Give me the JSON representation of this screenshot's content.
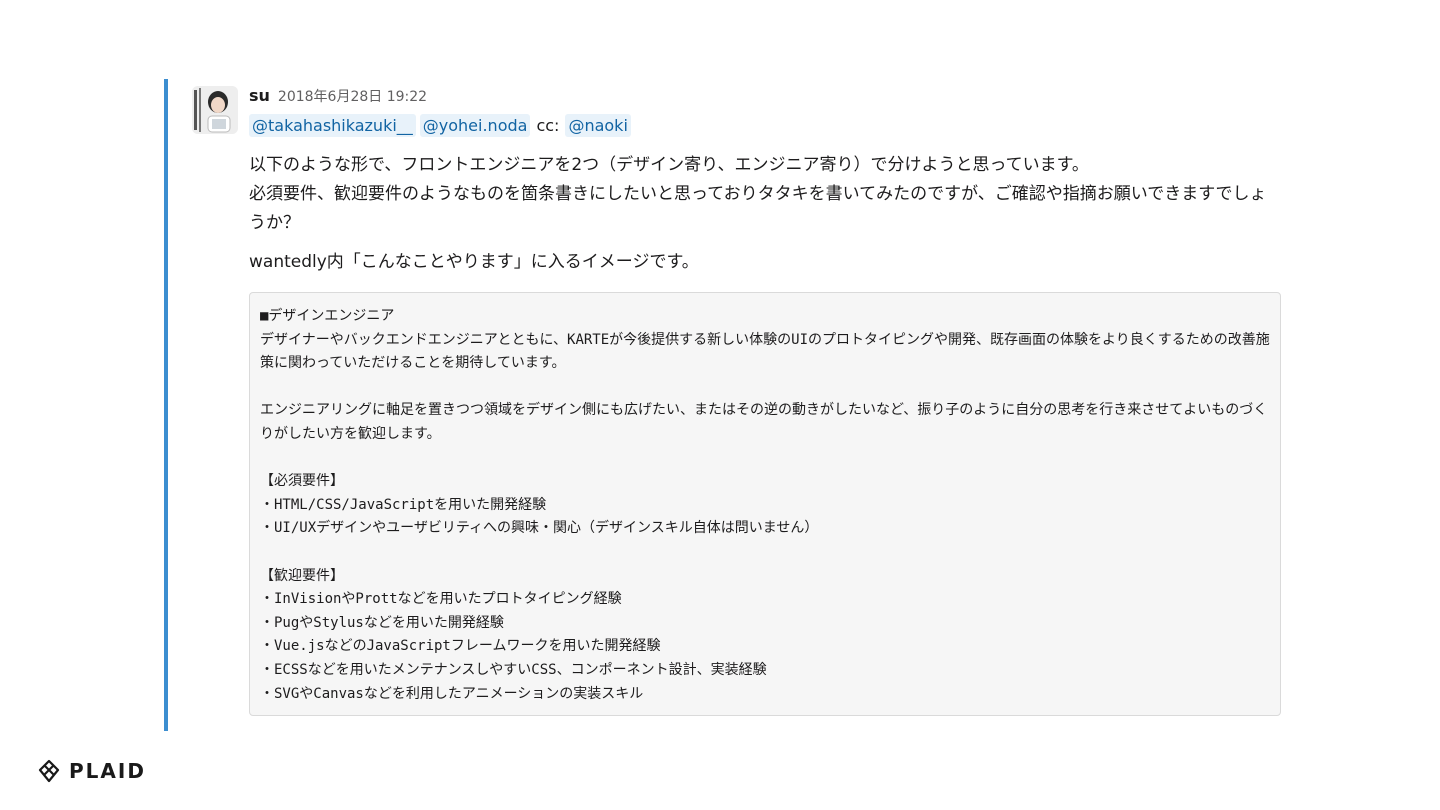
{
  "message": {
    "author": "su",
    "timestamp": "2018年6月28日 19:22",
    "mentions": [
      "@takahashikazuki__",
      "@yohei.noda"
    ],
    "cc_label": "cc:",
    "cc_mention": "@naoki",
    "paragraphs": [
      "以下のような形で、フロントエンジニアを2つ（デザイン寄り、エンジニア寄り）で分けようと思っています。",
      "必須要件、歓迎要件のようなものを箇条書きにしたいと思っておりタタキを書いてみたのですが、ご確認や指摘お願いできますでしょうか？",
      "wantedly内「こんなことやります」に入るイメージです。"
    ],
    "code_lines": [
      "■デザインエンジニア",
      "デザイナーやバックエンドエンジニアとともに、KARTEが今後提供する新しい体験のUIのプロトタイピングや開発、既存画面の体験をより良くするための改善施策に関わっていただけることを期待しています。",
      "",
      "エンジニアリングに軸足を置きつつ領域をデザイン側にも広げたい、またはその逆の動きがしたいなど、振り子のように自分の思考を行き来させてよいものづくりがしたい方を歓迎します。",
      "",
      "【必須要件】",
      "・HTML/CSS/JavaScriptを用いた開発経験",
      "・UI/UXデザインやユーザビリティへの興味・関心（デザインスキル自体は問いません）",
      "",
      "【歓迎要件】",
      "・InVisionやProttなどを用いたプロトタイピング経験",
      "・PugやStylusなどを用いた開発経験",
      "・Vue.jsなどのJavaScriptフレームワークを用いた開発経験",
      "・ECSSなどを用いたメンテナンスしやすいCSS、コンポーネント設計、実装経験",
      "・SVGやCanvasなどを利用したアニメーションの実装スキル"
    ]
  },
  "logo": {
    "text": "PLAID",
    "icon": "plaid-logo-icon"
  },
  "colors": {
    "quote_bar": "#3c8ed0",
    "mention_text": "#1264a3",
    "mention_bg": "#e8f2fa",
    "code_bg": "#f6f6f6",
    "code_border": "#dadada"
  }
}
